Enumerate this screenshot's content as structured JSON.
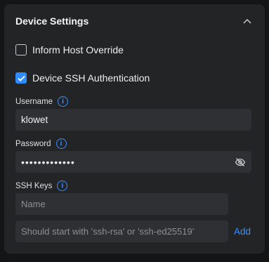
{
  "card": {
    "title": "Device Settings",
    "collapse_icon": "chevron-up-icon"
  },
  "options": {
    "inform_host_override": {
      "label": "Inform Host Override",
      "checked": false
    },
    "device_ssh_auth": {
      "label": "Device SSH Authentication",
      "checked": true
    }
  },
  "username": {
    "label": "Username",
    "value": "klowet"
  },
  "password": {
    "label": "Password",
    "masked_value": "•••••••••••••",
    "visibility_icon": "eye-off-icon"
  },
  "ssh_keys": {
    "label": "SSH Keys",
    "name_placeholder": "Name",
    "key_placeholder": "Should start with 'ssh-rsa' or 'ssh-ed25519'",
    "add_label": "Add"
  },
  "info_icon_glyph": "i",
  "colors": {
    "accent": "#2f8cff",
    "card_bg": "#232426",
    "input_bg": "#2f3033"
  }
}
